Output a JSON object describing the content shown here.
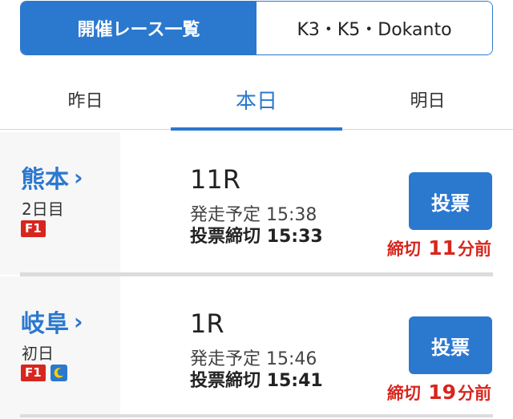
{
  "segment": {
    "active_label": "開催レース一覧",
    "inactive_label": "K3・K5・Dokanto"
  },
  "tabs": [
    {
      "label": "昨日"
    },
    {
      "label": "本日"
    },
    {
      "label": "明日"
    }
  ],
  "races": [
    {
      "venue": "熊本",
      "day": "2日目",
      "grade": "F1",
      "race_no": "11R",
      "start_label": "発走予定",
      "start_time": "15:38",
      "deadline_label": "投票締切",
      "deadline_time": "15:33",
      "vote_label": "投票",
      "countdown_prefix": "締切",
      "countdown_value": "11",
      "countdown_suffix": "分前"
    },
    {
      "venue": "岐阜",
      "day": "初日",
      "grade": "F1",
      "race_no": "1R",
      "start_label": "発走予定",
      "start_time": "15:46",
      "deadline_label": "投票締切",
      "deadline_time": "15:41",
      "vote_label": "投票",
      "countdown_prefix": "締切",
      "countdown_value": "19",
      "countdown_suffix": "分前"
    }
  ],
  "icons": {
    "chevron": "chevron-right-icon",
    "night": "moon-icon"
  },
  "colors": {
    "accent": "#2b78cf",
    "alert": "#d7261e"
  }
}
